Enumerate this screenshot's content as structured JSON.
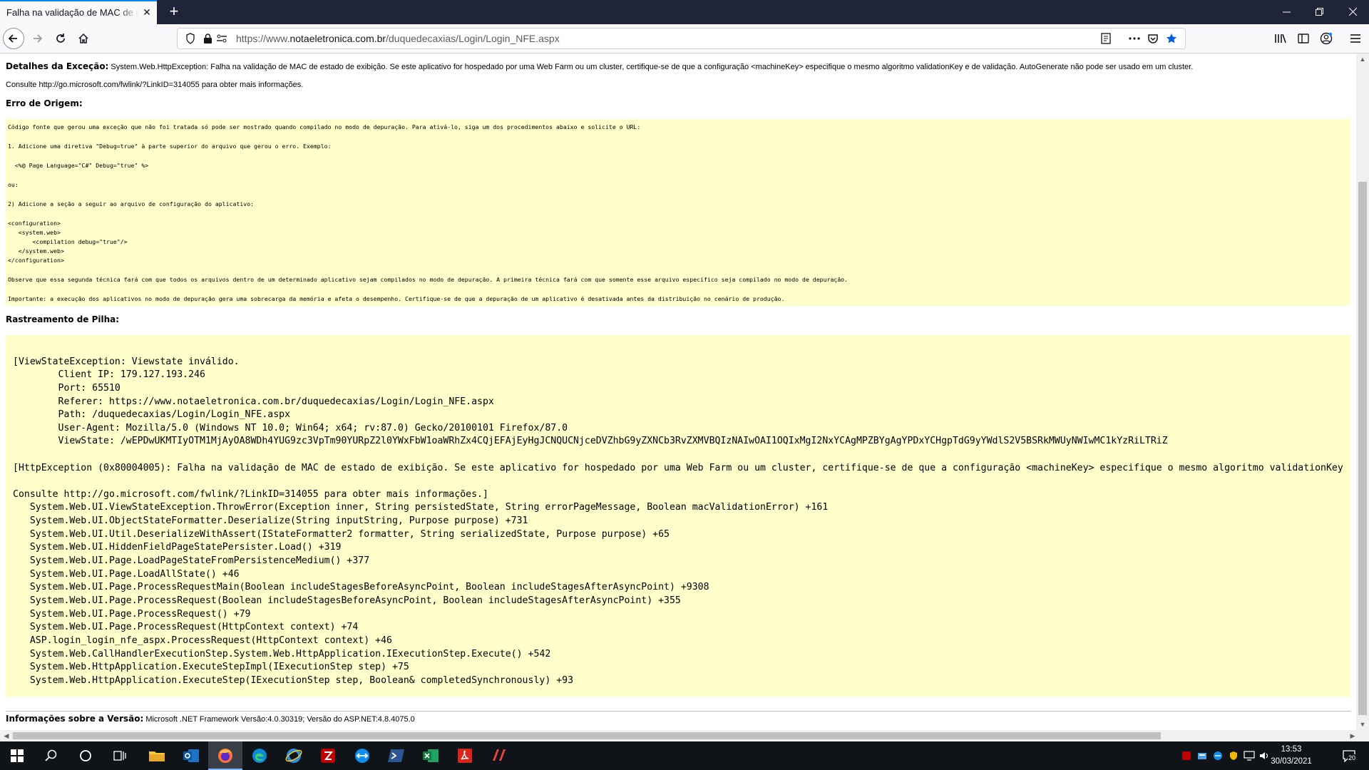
{
  "browser": {
    "tab_title": "Falha na validação de MAC de estado de exibição",
    "url_prefix": "https://www.",
    "url_domain": "notaeletronica.com.br",
    "url_path": "/duquedecaxias/Login/Login_NFE.aspx",
    "icons": {
      "close": "close-icon",
      "new_tab": "plus-icon",
      "back": "back-arrow-icon",
      "forward": "forward-arrow-icon",
      "reload": "reload-icon",
      "home": "home-icon",
      "shield": "shield-icon",
      "lock": "lock-icon",
      "permissions": "permissions-icon",
      "reader": "reader-view-icon",
      "more": "more-icon",
      "pocket": "pocket-icon",
      "bookmark": "star-icon",
      "library": "library-icon",
      "sidebar": "sidebar-icon",
      "account": "account-icon",
      "menu": "hamburger-menu-icon"
    }
  },
  "page": {
    "exception_label": "Detalhes da Exceção:",
    "exception_text": "System.Web.HttpException: Falha na validação de MAC de estado de exibição. Se este aplicativo for hospedado por uma Web Farm ou um cluster, certifique-se de que a configuração <machineKey> especifique o mesmo algoritmo validationKey e de validação. AutoGenerate não pode ser usado em um cluster.",
    "consult": "Consulte http://go.microsoft.com/fwlink/?LinkID=314055 para obter mais informações.",
    "source_error_heading": "Erro de Origem:",
    "source_error_lines": [
      "Código fonte que gerou uma exceção que não foi tratada só pode ser mostrado quando compilado no modo de depuração. Para ativá-lo, siga um dos procedimentos abaixo e solicite o URL:",
      "1. Adicione uma diretiva \"Debug=true\" à parte superior do arquivo que gerou o erro. Exemplo:",
      "  <%@ Page Language=\"C#\" Debug=\"true\" %>",
      "ou:",
      "2) Adicione a seção a seguir ao arquivo de configuração do aplicativo:",
      "<configuration>",
      "   <system.web>",
      "       <compilation debug=\"true\"/>",
      "   </system.web>",
      "</configuration>",
      "Observe que essa segunda técnica fará com que todos os arquivos dentro de um determinado aplicativo sejam compilados no modo de depuração. A primeira técnica fará com que somente esse arquivo específico seja compilado no modo de depuração.",
      "Importante: a execução dos aplicativos no modo de depuração gera uma sobrecarga da memória e afeta o desempenho. Certifique-se de que a depuração de um aplicativo é desativada antes da distribuição no cenário de produção."
    ],
    "stack_heading": "Rastreamento de Pilha:",
    "stack_lines": [
      "[ViewStateException: Viewstate inválido.",
      "        Client IP: 179.127.193.246",
      "        Port: 65510",
      "        Referer: https://www.notaeletronica.com.br/duquedecaxias/Login/Login_NFE.aspx",
      "        Path: /duquedecaxias/Login/Login_NFE.aspx",
      "        User-Agent: Mozilla/5.0 (Windows NT 10.0; Win64; x64; rv:87.0) Gecko/20100101 Firefox/87.0",
      "        ViewState: /wEPDwUKMTIyOTM1MjAyOA8WDh4YUG9zc3VpTm90YURpZ2l0YWxFbW1oaWRhZx4CQjEFAjEyHgJCNQUCNjceDVZhbG9yZXNCb3RvZXMVBQIzNAIwOAI1OQIxMgI2NxYCAgMPZBYgAgYPDxYCHgpTdG9yYWdlS2V5BSRkMWUyNWIwMC1kYzRiLTRiZ",
      "[HttpException (0x80004005): Falha na validação de MAC de estado de exibição. Se este aplicativo for hospedado por uma Web Farm ou um cluster, certifique-se de que a configuração <machineKey> especifique o mesmo algoritmo validationKey",
      "Consulte http://go.microsoft.com/fwlink/?LinkID=314055 para obter mais informações.]",
      "   System.Web.UI.ViewStateException.ThrowError(Exception inner, String persistedState, String errorPageMessage, Boolean macValidationError) +161",
      "   System.Web.UI.ObjectStateFormatter.Deserialize(String inputString, Purpose purpose) +731",
      "   System.Web.UI.Util.DeserializeWithAssert(IStateFormatter2 formatter, String serializedState, Purpose purpose) +65",
      "   System.Web.UI.HiddenFieldPageStatePersister.Load() +319",
      "   System.Web.UI.Page.LoadPageStateFromPersistenceMedium() +377",
      "   System.Web.UI.Page.LoadAllState() +46",
      "   System.Web.UI.Page.ProcessRequestMain(Boolean includeStagesBeforeAsyncPoint, Boolean includeStagesAfterAsyncPoint) +9308",
      "   System.Web.UI.Page.ProcessRequest(Boolean includeStagesBeforeAsyncPoint, Boolean includeStagesAfterAsyncPoint) +355",
      "   System.Web.UI.Page.ProcessRequest() +79",
      "   System.Web.UI.Page.ProcessRequest(HttpContext context) +74",
      "   ASP.login_login_nfe_aspx.ProcessRequest(HttpContext context) +46",
      "   System.Web.CallHandlerExecutionStep.System.Web.HttpApplication.IExecutionStep.Execute() +542",
      "   System.Web.HttpApplication.ExecuteStepImpl(IExecutionStep step) +75",
      "   System.Web.HttpApplication.ExecuteStep(IExecutionStep step, Boolean& completedSynchronously) +93"
    ],
    "version_label": "Informações sobre a Versão:",
    "version_text": "Microsoft .NET Framework Versão:4.0.30319; Versão do ASP.NET:4.8.4075.0"
  },
  "taskbar": {
    "apps": [
      "windows-start-icon",
      "search-icon",
      "cortana-icon",
      "task-view-icon",
      "file-explorer-icon",
      "outlook-icon",
      "firefox-icon",
      "edge-icon",
      "internet-explorer-icon",
      "filezilla-icon",
      "teamviewer-icon",
      "powershell-icon",
      "excel-icon",
      "adobe-reader-icon",
      "anydesk-icon"
    ],
    "time": "13:53",
    "date": "30/03/2021",
    "notification_count": "20"
  },
  "colors": {
    "tab_strip": "#1f2439",
    "toolbar": "#f9f9fb",
    "code_background": "#ffffcc",
    "accent": "#0a84ff",
    "taskbar": "#101419"
  }
}
